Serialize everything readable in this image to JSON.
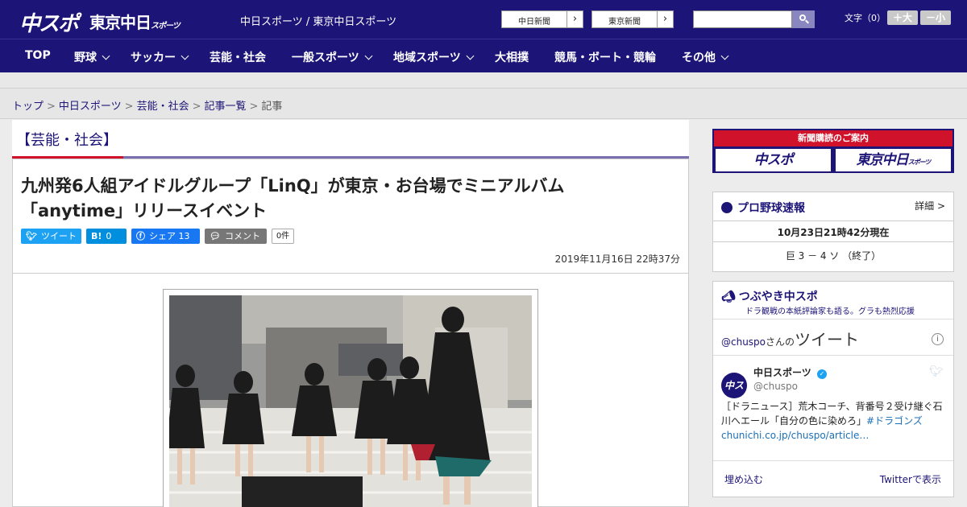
{
  "header": {
    "logo_main": "中スポ",
    "logo_tokyo": "東京中日",
    "logo_tokyo_sub": "スポーツ",
    "site_links": "中日スポーツ / 東京中日スポーツ",
    "paper_buttons": [
      "中日新聞",
      "東京新聞"
    ],
    "search_placeholder": "",
    "font_size_label": "文字（0）",
    "font_larger": "＋大",
    "font_smaller": "－小"
  },
  "nav": {
    "items": [
      "TOP",
      "野球",
      "サッカー",
      "芸能・社会",
      "一般スポーツ",
      "地域スポーツ",
      "大相撲",
      "競馬・ボート・競輪",
      "その他"
    ]
  },
  "breadcrumb": {
    "items": [
      "トップ",
      "中日スポーツ",
      "芸能・社会",
      "記事一覧",
      "記事"
    ],
    "separator": ">"
  },
  "article": {
    "category": "【芸能・社会】",
    "title_line1": "九州発6人組アイドルグループ「LinQ」が東京・お台場でミニアルバム",
    "title_line2": "「anytime」リリースイベント",
    "share": {
      "tweet": "ツイート",
      "hatena_icon": "B!",
      "hatena_count": "0",
      "facebook": "シェア",
      "facebook_count": "13",
      "comment": "コメント",
      "comment_count": "0件"
    },
    "date": "2019年11月16日 22時37分"
  },
  "sidebar": {
    "ad_label": "新聞購読のご案内",
    "ad_paper1": "中スポ",
    "ad_paper2": "東京中日",
    "ad_paper2_sub": "スポーツ",
    "baseball": {
      "title": "プロ野球速報",
      "detail": "詳細 >",
      "timestamp": "10月23日21時42分現在",
      "score": "巨 3 － 4 ソ （終了）"
    },
    "tsubuyaki": {
      "title": "つぶやき中スポ",
      "subtitle": "ドラ観戦の本紙評論家も語る。グラも熱烈応援",
      "handle": "@chuspo",
      "handle_suffix": "さんの",
      "tweets_label": "ツイート",
      "account_name": "中日スポーツ",
      "account_handle": "@chuspo",
      "avatar_text": "中スポ",
      "tweet_text": "［ドラニュース］荒木コーチ、背番号２受け継ぐ石川へエール「自分の色に染めろ」",
      "tweet_hashtag": "#ドラゴンズ",
      "tweet_link": "chunichi.co.jp/chuspo/article…",
      "embed": "埋め込む",
      "view_on_twitter": "Twitterで表示"
    }
  },
  "colors": {
    "brand_navy": "#1c1476",
    "accent_red": "#d0122a",
    "twitter_blue": "#1da1f2",
    "hatena_blue": "#008fde",
    "facebook_blue": "#1877f2"
  }
}
